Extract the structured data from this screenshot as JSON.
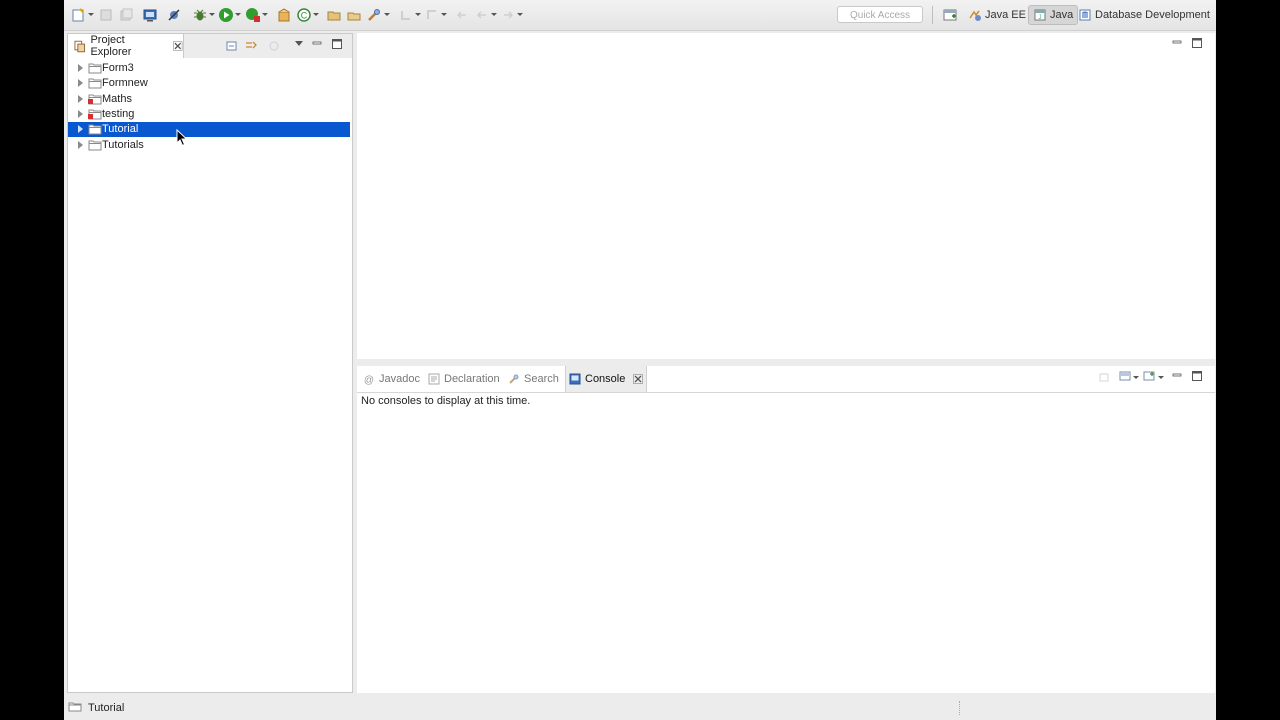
{
  "toolbar": {
    "quick_access_placeholder": "Quick Access",
    "perspectives": [
      {
        "label": "Java EE",
        "icon": "java-ee-perspective-icon",
        "active": false
      },
      {
        "label": "Java",
        "icon": "java-perspective-icon",
        "active": true
      },
      {
        "label": "Database Development",
        "icon": "database-perspective-icon",
        "active": false
      }
    ]
  },
  "explorer": {
    "title": "Project Explorer",
    "projects": [
      {
        "label": "Form3",
        "selected": false,
        "error": false
      },
      {
        "label": "Formnew",
        "selected": false,
        "error": false
      },
      {
        "label": "Maths",
        "selected": false,
        "error": true
      },
      {
        "label": "testing",
        "selected": false,
        "error": true
      },
      {
        "label": "Tutorial",
        "selected": true,
        "error": false
      },
      {
        "label": "Tutorials",
        "selected": false,
        "error": false
      }
    ]
  },
  "console": {
    "tabs": [
      {
        "label": "Javadoc",
        "icon": "javadoc-icon",
        "active": false
      },
      {
        "label": "Declaration",
        "icon": "declaration-icon",
        "active": false
      },
      {
        "label": "Search",
        "icon": "search-icon",
        "active": false
      },
      {
        "label": "Console",
        "icon": "console-icon",
        "active": true
      }
    ],
    "message": "No consoles to display at this time."
  },
  "statusbar": {
    "text": "Tutorial"
  },
  "colors": {
    "selection": "#0a58d0",
    "window_bg": "#ececec"
  }
}
